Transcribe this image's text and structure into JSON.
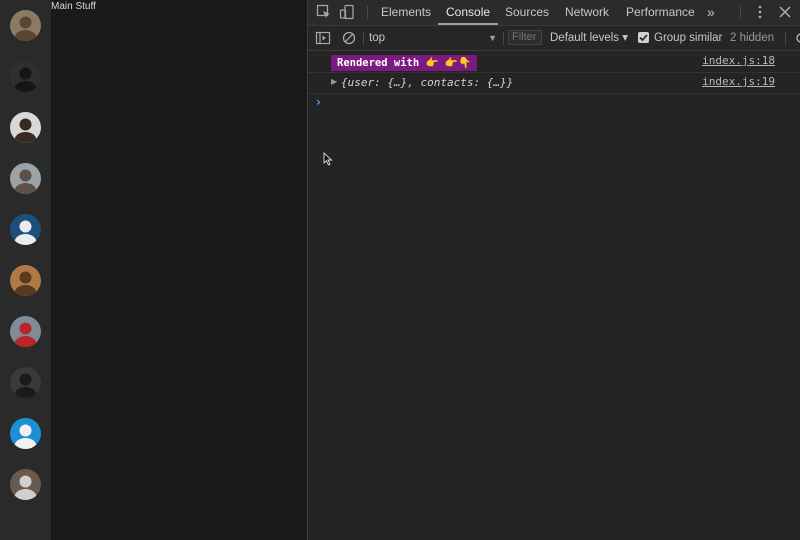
{
  "app": {
    "title": "Main Stuff",
    "contacts": [
      {
        "name": "avatar-1",
        "bg": "#8a7a66",
        "fg": "#5a4632"
      },
      {
        "name": "avatar-2",
        "bg": "#2f2f2f",
        "fg": "#151515"
      },
      {
        "name": "avatar-3",
        "bg": "#d8d8d8",
        "fg": "#3a2b22"
      },
      {
        "name": "avatar-4",
        "bg": "#9aa3a8",
        "fg": "#5c5047"
      },
      {
        "name": "avatar-5",
        "bg": "#1e4e7a",
        "fg": "#e8edf2"
      },
      {
        "name": "avatar-6",
        "bg": "#b07a45",
        "fg": "#5a3a1f"
      },
      {
        "name": "avatar-7",
        "bg": "#7f8b95",
        "fg": "#b8262c"
      },
      {
        "name": "avatar-8",
        "bg": "#3a3a3a",
        "fg": "#1a1a1a"
      },
      {
        "name": "avatar-9",
        "bg": "#1c8fd6",
        "fg": "#f2f2f2"
      },
      {
        "name": "avatar-10",
        "bg": "#6a5a4e",
        "fg": "#cfcfcf"
      }
    ]
  },
  "devtools": {
    "tabs": [
      "Elements",
      "Console",
      "Sources",
      "Network",
      "Performance"
    ],
    "active_tab": "Console",
    "more_tabs_label": "»",
    "toolbar": {
      "context": "top",
      "filter_placeholder": "Filter",
      "levels": "Default levels ▾",
      "group_similar_label": "Group similar",
      "group_similar_checked": true,
      "hidden_count": "2 hidden"
    },
    "console": {
      "messages": [
        {
          "text": "Rendered with 👉 👉👇",
          "source": "index.js:18"
        },
        {
          "text": "{user: {…}, contacts: {…}}",
          "source": "index.js:19"
        }
      ],
      "prompt": "›"
    }
  },
  "colors": {
    "badge_bg": "#7b1b80",
    "prompt": "#4e9cf5"
  }
}
